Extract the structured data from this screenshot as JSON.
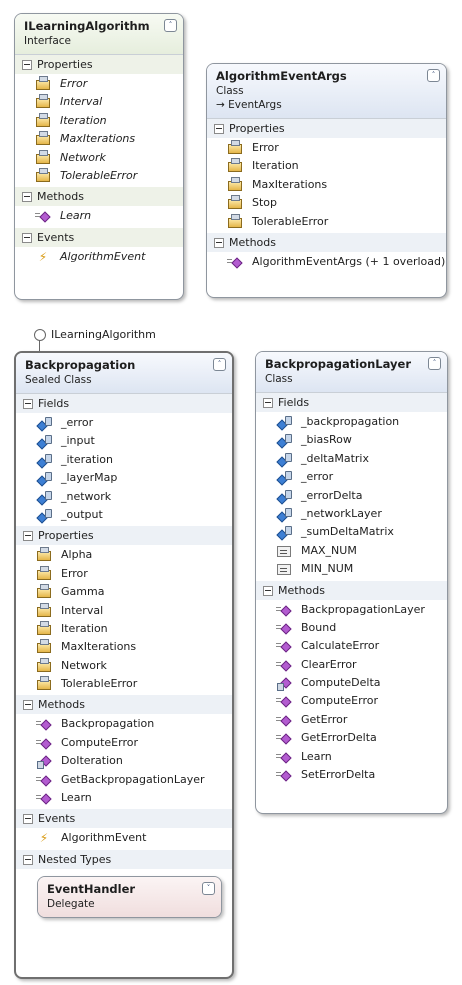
{
  "toggle_glyph": "˄",
  "nested_toggle_glyph": "˅",
  "lollipop_label": "ILearningAlgorithm",
  "iface": {
    "title": "ILearningAlgorithm",
    "stereotype": "Interface",
    "sections": [
      {
        "label": "Properties",
        "items": [
          {
            "name": "Error",
            "icon": "property-icon"
          },
          {
            "name": "Interval",
            "icon": "property-icon"
          },
          {
            "name": "Iteration",
            "icon": "property-icon"
          },
          {
            "name": "MaxIterations",
            "icon": "property-icon"
          },
          {
            "name": "Network",
            "icon": "property-icon"
          },
          {
            "name": "TolerableError",
            "icon": "property-icon"
          }
        ]
      },
      {
        "label": "Methods",
        "items": [
          {
            "name": "Learn",
            "icon": "method-icon"
          }
        ]
      },
      {
        "label": "Events",
        "items": [
          {
            "name": "AlgorithmEvent",
            "icon": "event-icon"
          }
        ]
      }
    ]
  },
  "args": {
    "title": "AlgorithmEventArgs",
    "stereotype": "Class",
    "base": "→ EventArgs",
    "sections": [
      {
        "label": "Properties",
        "items": [
          {
            "name": "Error",
            "icon": "property-icon"
          },
          {
            "name": "Iteration",
            "icon": "property-icon"
          },
          {
            "name": "MaxIterations",
            "icon": "property-icon"
          },
          {
            "name": "Stop",
            "icon": "property-icon"
          },
          {
            "name": "TolerableError",
            "icon": "property-icon"
          }
        ]
      },
      {
        "label": "Methods",
        "items": [
          {
            "name": "AlgorithmEventArgs (+ 1 overload)",
            "icon": "method-icon"
          }
        ]
      }
    ]
  },
  "backprop": {
    "title": "Backpropagation",
    "stereotype": "Sealed Class",
    "sections": [
      {
        "label": "Fields",
        "items": [
          {
            "name": "_error",
            "icon": "field-icon"
          },
          {
            "name": "_input",
            "icon": "field-icon"
          },
          {
            "name": "_iteration",
            "icon": "field-icon"
          },
          {
            "name": "_layerMap",
            "icon": "field-icon"
          },
          {
            "name": "_network",
            "icon": "field-icon"
          },
          {
            "name": "_output",
            "icon": "field-icon"
          }
        ]
      },
      {
        "label": "Properties",
        "items": [
          {
            "name": "Alpha",
            "icon": "property-icon"
          },
          {
            "name": "Error",
            "icon": "property-icon"
          },
          {
            "name": "Gamma",
            "icon": "property-icon"
          },
          {
            "name": "Interval",
            "icon": "property-icon"
          },
          {
            "name": "Iteration",
            "icon": "property-icon"
          },
          {
            "name": "MaxIterations",
            "icon": "property-icon"
          },
          {
            "name": "Network",
            "icon": "property-icon"
          },
          {
            "name": "TolerableError",
            "icon": "property-icon"
          }
        ]
      },
      {
        "label": "Methods",
        "items": [
          {
            "name": "Backpropagation",
            "icon": "method-icon"
          },
          {
            "name": "ComputeError",
            "icon": "method-icon"
          },
          {
            "name": "DoIteration",
            "icon": "private-method-icon"
          },
          {
            "name": "GetBackpropagationLayer",
            "icon": "method-icon"
          },
          {
            "name": "Learn",
            "icon": "method-icon"
          }
        ]
      },
      {
        "label": "Events",
        "items": [
          {
            "name": "AlgorithmEvent",
            "icon": "event-icon"
          }
        ]
      }
    ],
    "nested_label": "Nested Types",
    "nested": {
      "title": "EventHandler",
      "stereotype": "Delegate"
    }
  },
  "layer": {
    "title": "BackpropagationLayer",
    "stereotype": "Class",
    "sections": [
      {
        "label": "Fields",
        "items": [
          {
            "name": "_backpropagation",
            "icon": "field-icon"
          },
          {
            "name": "_biasRow",
            "icon": "field-icon"
          },
          {
            "name": "_deltaMatrix",
            "icon": "field-icon"
          },
          {
            "name": "_error",
            "icon": "field-icon"
          },
          {
            "name": "_errorDelta",
            "icon": "field-icon"
          },
          {
            "name": "_networkLayer",
            "icon": "field-icon"
          },
          {
            "name": "_sumDeltaMatrix",
            "icon": "field-icon"
          },
          {
            "name": "MAX_NUM",
            "icon": "constant-icon"
          },
          {
            "name": "MIN_NUM",
            "icon": "constant-icon"
          }
        ]
      },
      {
        "label": "Methods",
        "items": [
          {
            "name": "BackpropagationLayer",
            "icon": "method-icon"
          },
          {
            "name": "Bound",
            "icon": "method-icon"
          },
          {
            "name": "CalculateError",
            "icon": "method-icon"
          },
          {
            "name": "ClearError",
            "icon": "method-icon"
          },
          {
            "name": "ComputeDelta",
            "icon": "private-method-icon"
          },
          {
            "name": "ComputeError",
            "icon": "method-icon"
          },
          {
            "name": "GetError",
            "icon": "method-icon"
          },
          {
            "name": "GetErrorDelta",
            "icon": "method-icon"
          },
          {
            "name": "Learn",
            "icon": "method-icon"
          },
          {
            "name": "SetErrorDelta",
            "icon": "method-icon"
          }
        ]
      }
    ]
  }
}
